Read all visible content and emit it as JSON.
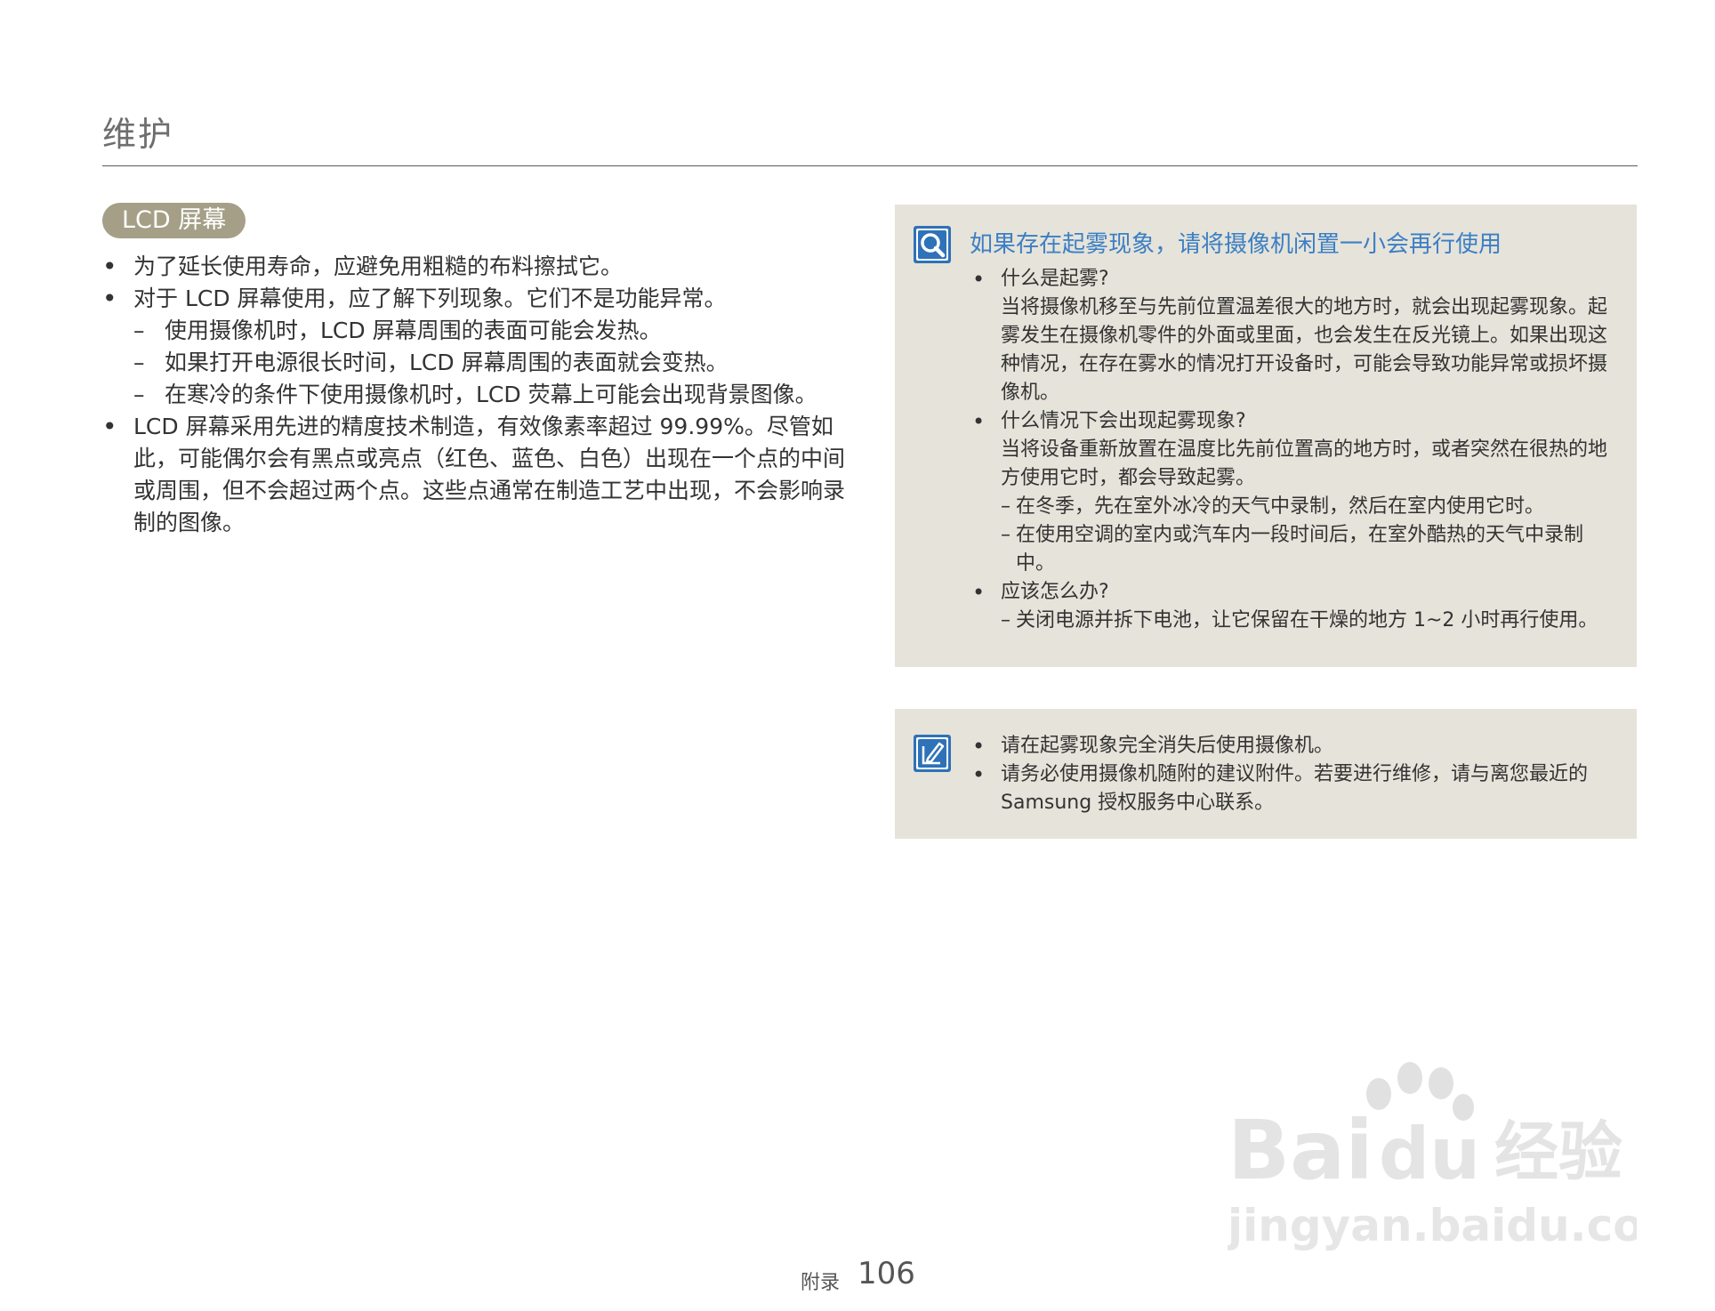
{
  "page": {
    "title": "维护"
  },
  "section": {
    "label": "LCD 屏幕"
  },
  "left": {
    "b1": "为了延长使用寿命，应避免用粗糙的布料擦拭它。",
    "b2": "对于 LCD 屏幕使用，应了解下列现象。它们不是功能异常。",
    "d1": "使用摄像机时，LCD 屏幕周围的表面可能会发热。",
    "d2": "如果打开电源很长时间，LCD 屏幕周围的表面就会变热。",
    "d3": "在寒冷的条件下使用摄像机时，LCD 荧幕上可能会出现背景图像。",
    "b3": "LCD 屏幕采用先进的精度技术制造，有效像素率超过 99.99%。尽管如此，可能偶尔会有黑点或亮点（红色、蓝色、白色）出现在一个点的中间或周围，但不会超过两个点。这些点通常在制造工艺中出现，不会影响录制的图像。"
  },
  "fog_box": {
    "title": "如果存在起雾现象，请将摄像机闲置一小会再行使用",
    "q1": "什么是起雾?",
    "a1": "当将摄像机移至与先前位置温差很大的地方时，就会出现起雾现象。起雾发生在摄像机零件的外面或里面，也会发生在反光镜上。如果出现这种情况，在存在雾水的情况打开设备时，可能会导致功能异常或损坏摄像机。",
    "q2": "什么情况下会出现起雾现象?",
    "a2": "当将设备重新放置在温度比先前位置高的地方时，或者突然在很热的地方使用它时，都会导致起雾。",
    "a2_d1": "在冬季，先在室外冰冷的天气中录制，然后在室内使用它时。",
    "a2_d2": "在使用空调的室内或汽车内一段时间后，在室外酷热的天气中录制中。",
    "q3": "应该怎么办?",
    "a3_d1": "关闭电源并拆下电池，让它保留在干燥的地方 1~2 小时再行使用。"
  },
  "note_box": {
    "n1": "请在起雾现象完全消失后使用摄像机。",
    "n2": "请务必使用摄像机随附的建议附件。若要进行维修，请与离您最近的 Samsung 授权服务中心联系。"
  },
  "footer": {
    "label": "附录",
    "page_number": "106"
  },
  "watermark": {
    "brand_left": "Bai",
    "brand_right": "du",
    "brand_cn": "经验",
    "url": "jingyan.baidu.com"
  },
  "colors": {
    "accent": "#3b7fc4",
    "pill": "#a49f86",
    "box_bg": "#e6e3da"
  },
  "icons": [
    "search-icon",
    "note-pencil-icon",
    "paw-icon"
  ]
}
